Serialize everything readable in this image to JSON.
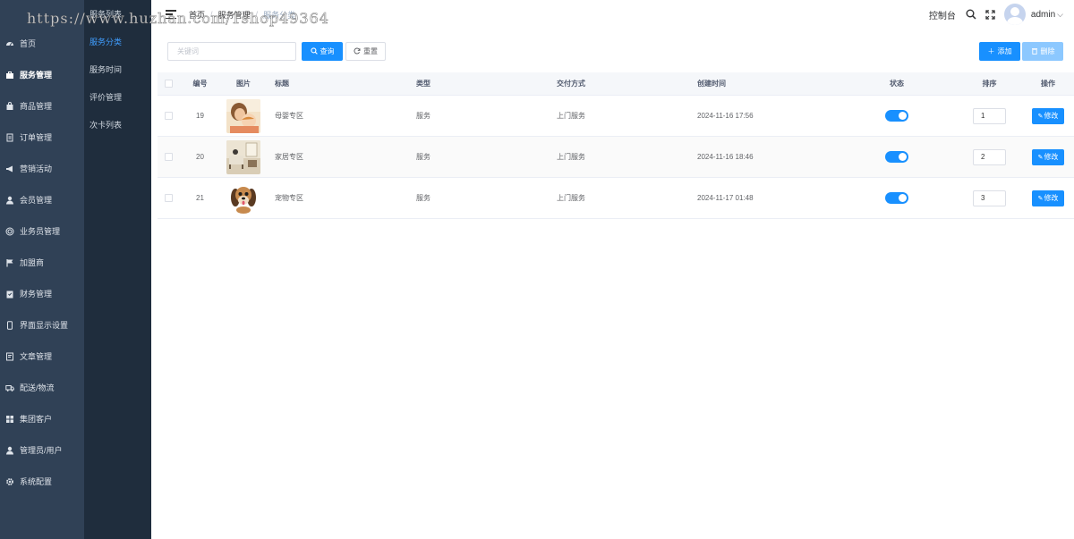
{
  "watermark": "https://www.huzhan.com/1shop49364",
  "sidebar": {
    "items": [
      {
        "label": "首页",
        "icon": "dashboard-icon"
      },
      {
        "label": "服务管理",
        "icon": "briefcase-icon",
        "active": true
      },
      {
        "label": "商品管理",
        "icon": "shopping-bag-icon"
      },
      {
        "label": "订单管理",
        "icon": "order-icon"
      },
      {
        "label": "营销活动",
        "icon": "megaphone-icon"
      },
      {
        "label": "会员管理",
        "icon": "user-icon"
      },
      {
        "label": "业务员管理",
        "icon": "target-icon"
      },
      {
        "label": "加盟商",
        "icon": "flag-icon"
      },
      {
        "label": "财务管理",
        "icon": "finance-icon"
      },
      {
        "label": "界面显示设置",
        "icon": "phone-icon"
      },
      {
        "label": "文章管理",
        "icon": "document-icon"
      },
      {
        "label": "配送/物流",
        "icon": "truck-icon"
      },
      {
        "label": "集团客户",
        "icon": "grid-icon"
      },
      {
        "label": "管理员/用户",
        "icon": "admin-user-icon"
      },
      {
        "label": "系统配置",
        "icon": "gear-icon"
      }
    ]
  },
  "subbar": {
    "items": [
      {
        "label": "服务列表"
      },
      {
        "label": "服务分类",
        "active": true
      },
      {
        "label": "服务时间"
      },
      {
        "label": "评价管理"
      },
      {
        "label": "次卡列表"
      }
    ]
  },
  "header": {
    "breadcrumb": [
      "首页",
      "服务管理",
      "服务分类"
    ],
    "console_label": "控制台",
    "username": "admin"
  },
  "toolbar": {
    "search_placeholder": "关键词",
    "query_label": "查询",
    "reset_label": "重置",
    "add_label": "添加",
    "delete_label": "删除"
  },
  "table": {
    "columns": [
      "编号",
      "图片",
      "标题",
      "类型",
      "交付方式",
      "创建时间",
      "状态",
      "排序",
      "操作"
    ],
    "edit_label": "修改",
    "rows": [
      {
        "id": "19",
        "image": "mother-baby-photo",
        "title": "母婴专区",
        "type": "服务",
        "delivery": "上门服务",
        "created": "2024-11-16 17:56",
        "status": true,
        "sort": "1"
      },
      {
        "id": "20",
        "image": "home-interior-photo",
        "title": "家居专区",
        "type": "服务",
        "delivery": "上门服务",
        "created": "2024-11-16 18:46",
        "status": true,
        "sort": "2"
      },
      {
        "id": "21",
        "image": "puppy-photo",
        "title": "宠物专区",
        "type": "服务",
        "delivery": "上门服务",
        "created": "2024-11-17 01:48",
        "status": true,
        "sort": "3"
      }
    ]
  },
  "colors": {
    "primary": "#1890ff",
    "sidebar_bg": "#304156",
    "subbar_bg": "#1f2d3d",
    "active_sub": "#409eff"
  }
}
